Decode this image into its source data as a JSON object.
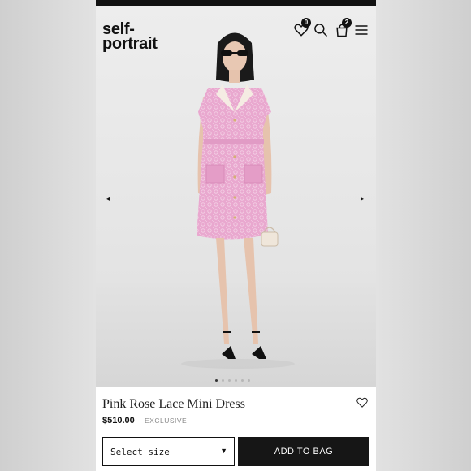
{
  "brand": {
    "line1": "self-",
    "line2": "portrait"
  },
  "header": {
    "wishlist_count": "0",
    "bag_count": "2",
    "icons": [
      "heart-icon",
      "search-icon",
      "bag-icon",
      "menu-icon"
    ]
  },
  "gallery": {
    "prev_icon": "◂",
    "next_icon": "▸",
    "slide_count": 6,
    "active_slide": 1
  },
  "product": {
    "name": "Pink Rose Lace Mini Dress",
    "price": "$510.00",
    "tag": "EXCLUSIVE"
  },
  "actions": {
    "size_placeholder": "Select size",
    "add_to_bag": "ADD TO BAG"
  },
  "colors": {
    "dress": "#e9a8cf",
    "collar": "#f5ece3",
    "button_bg": "#161616"
  }
}
